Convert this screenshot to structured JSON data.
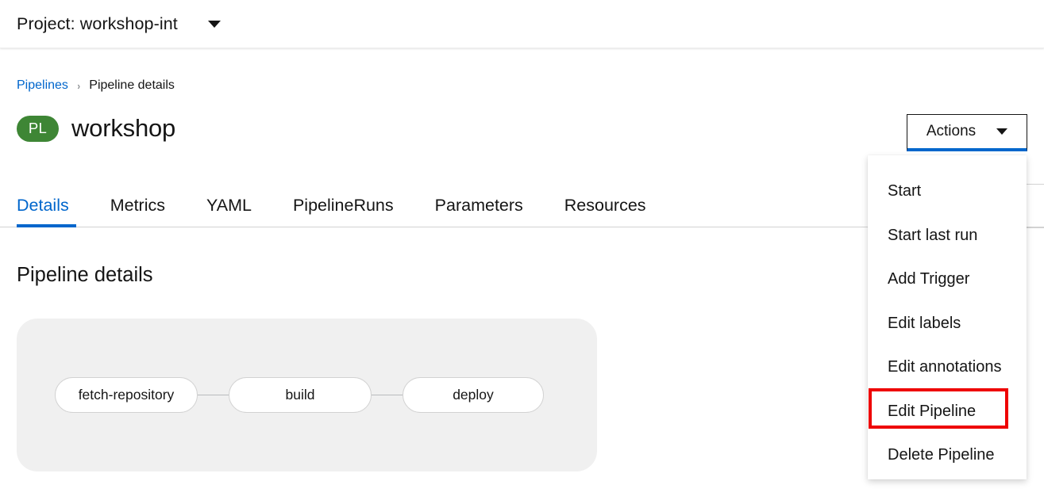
{
  "project_bar": {
    "label": "Project: workshop-int",
    "caret_icon": "chevron-down-icon"
  },
  "breadcrumb": {
    "parent": "Pipelines",
    "separator": "›",
    "current": "Pipeline details"
  },
  "header": {
    "badge": "PL",
    "badge_color": "#3e8635",
    "title": "workshop",
    "actions_label": "Actions",
    "actions_caret_icon": "caret-down-icon",
    "accent_color": "#0066cc"
  },
  "tabs": [
    {
      "label": "Details",
      "active": true
    },
    {
      "label": "Metrics",
      "active": false
    },
    {
      "label": "YAML",
      "active": false
    },
    {
      "label": "PipelineRuns",
      "active": false
    },
    {
      "label": "Parameters",
      "active": false
    },
    {
      "label": "Resources",
      "active": false
    }
  ],
  "main": {
    "section_heading": "Pipeline details"
  },
  "pipeline": {
    "nodes": [
      {
        "label": "fetch-repository"
      },
      {
        "label": "build"
      },
      {
        "label": "deploy"
      }
    ],
    "background_color": "#f0f0f0",
    "node_border_color": "#d2d2d2"
  },
  "actions_menu": {
    "items": [
      {
        "label": "Start",
        "highlighted": false
      },
      {
        "label": "Start last run",
        "highlighted": false
      },
      {
        "label": "Add Trigger",
        "highlighted": false
      },
      {
        "label": "Edit labels",
        "highlighted": false
      },
      {
        "label": "Edit annotations",
        "highlighted": false
      },
      {
        "label": "Edit Pipeline",
        "highlighted": true
      },
      {
        "label": "Delete Pipeline",
        "highlighted": false
      }
    ],
    "highlight_color": "#ee0000"
  }
}
